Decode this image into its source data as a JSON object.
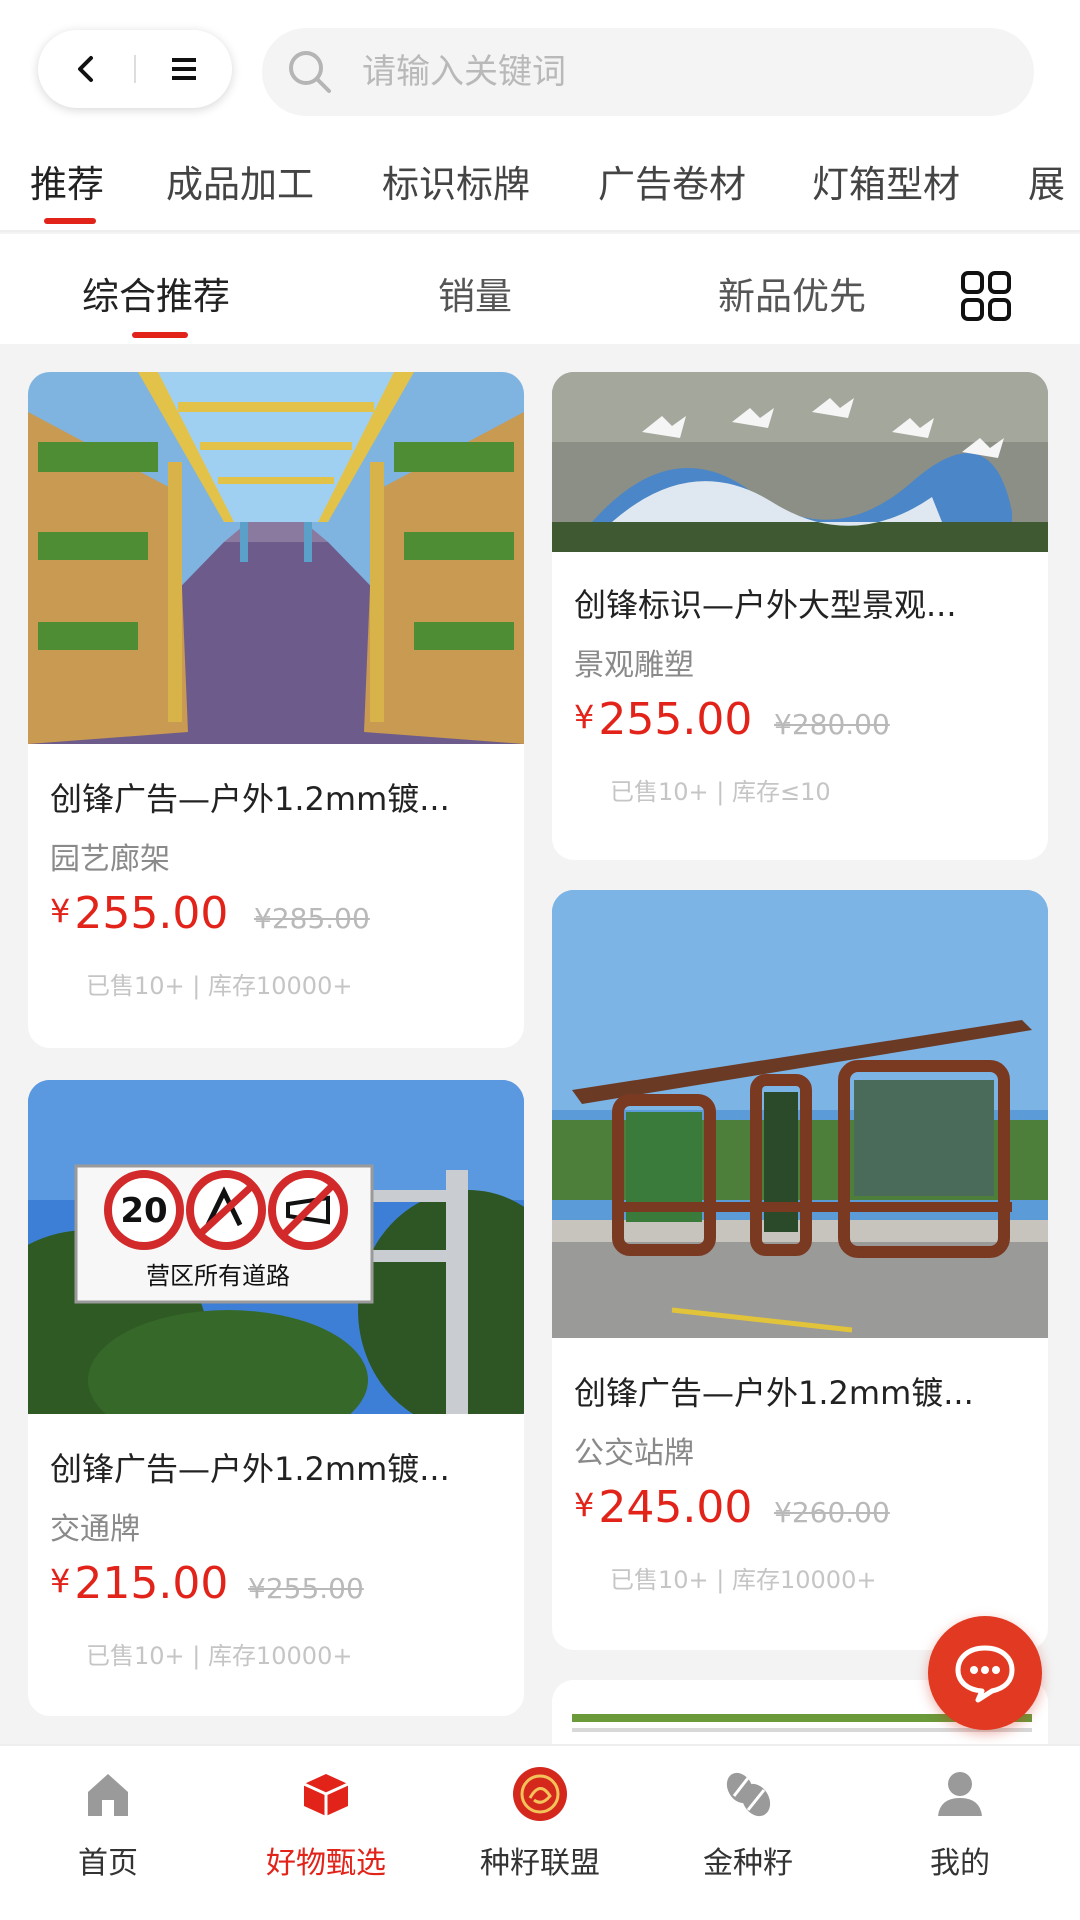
{
  "header": {
    "search_placeholder": "请输入关键词"
  },
  "categories": [
    {
      "label": "推荐",
      "active": true
    },
    {
      "label": "成品加工"
    },
    {
      "label": "标识标牌"
    },
    {
      "label": "广告卷材"
    },
    {
      "label": "灯箱型材"
    },
    {
      "label": "展"
    }
  ],
  "sort": {
    "options": [
      "综合推荐",
      "销量",
      "新品优先"
    ],
    "active": "综合推荐"
  },
  "products": [
    {
      "title": "创锋广告—户外1.2mm镀...",
      "category": "园艺廊架",
      "currency": "¥",
      "price": "255.00",
      "original_price": "¥285.00",
      "meta": "已售10+ | 库存10000+"
    },
    {
      "title": "创锋标识—户外大型景观...",
      "category": "景观雕塑",
      "currency": "¥",
      "price": "255.00",
      "original_price": "¥280.00",
      "meta": "已售10+ | 库存≤10"
    },
    {
      "title": "创锋广告—户外1.2mm镀...",
      "category": "交通牌",
      "currency": "¥",
      "price": "215.00",
      "original_price": "¥255.00",
      "meta": "已售10+ | 库存10000+"
    },
    {
      "title": "创锋广告—户外1.2mm镀...",
      "category": "公交站牌",
      "currency": "¥",
      "price": "245.00",
      "original_price": "¥260.00",
      "meta": "已售10+ | 库存10000+"
    }
  ],
  "sign_image": {
    "speed_limit": "20",
    "caption": "营区所有道路"
  },
  "tabbar": [
    {
      "label": "首页",
      "icon": "home-icon"
    },
    {
      "label": "好物甄选",
      "icon": "box-icon",
      "active": true
    },
    {
      "label": "种籽联盟",
      "icon": "alliance-logo-icon"
    },
    {
      "label": "金种籽",
      "icon": "seeds-icon"
    },
    {
      "label": "我的",
      "icon": "user-icon"
    }
  ],
  "colors": {
    "accent": "#e2231a",
    "muted": "#8a8a8a",
    "strike": "#b9b9b9"
  }
}
